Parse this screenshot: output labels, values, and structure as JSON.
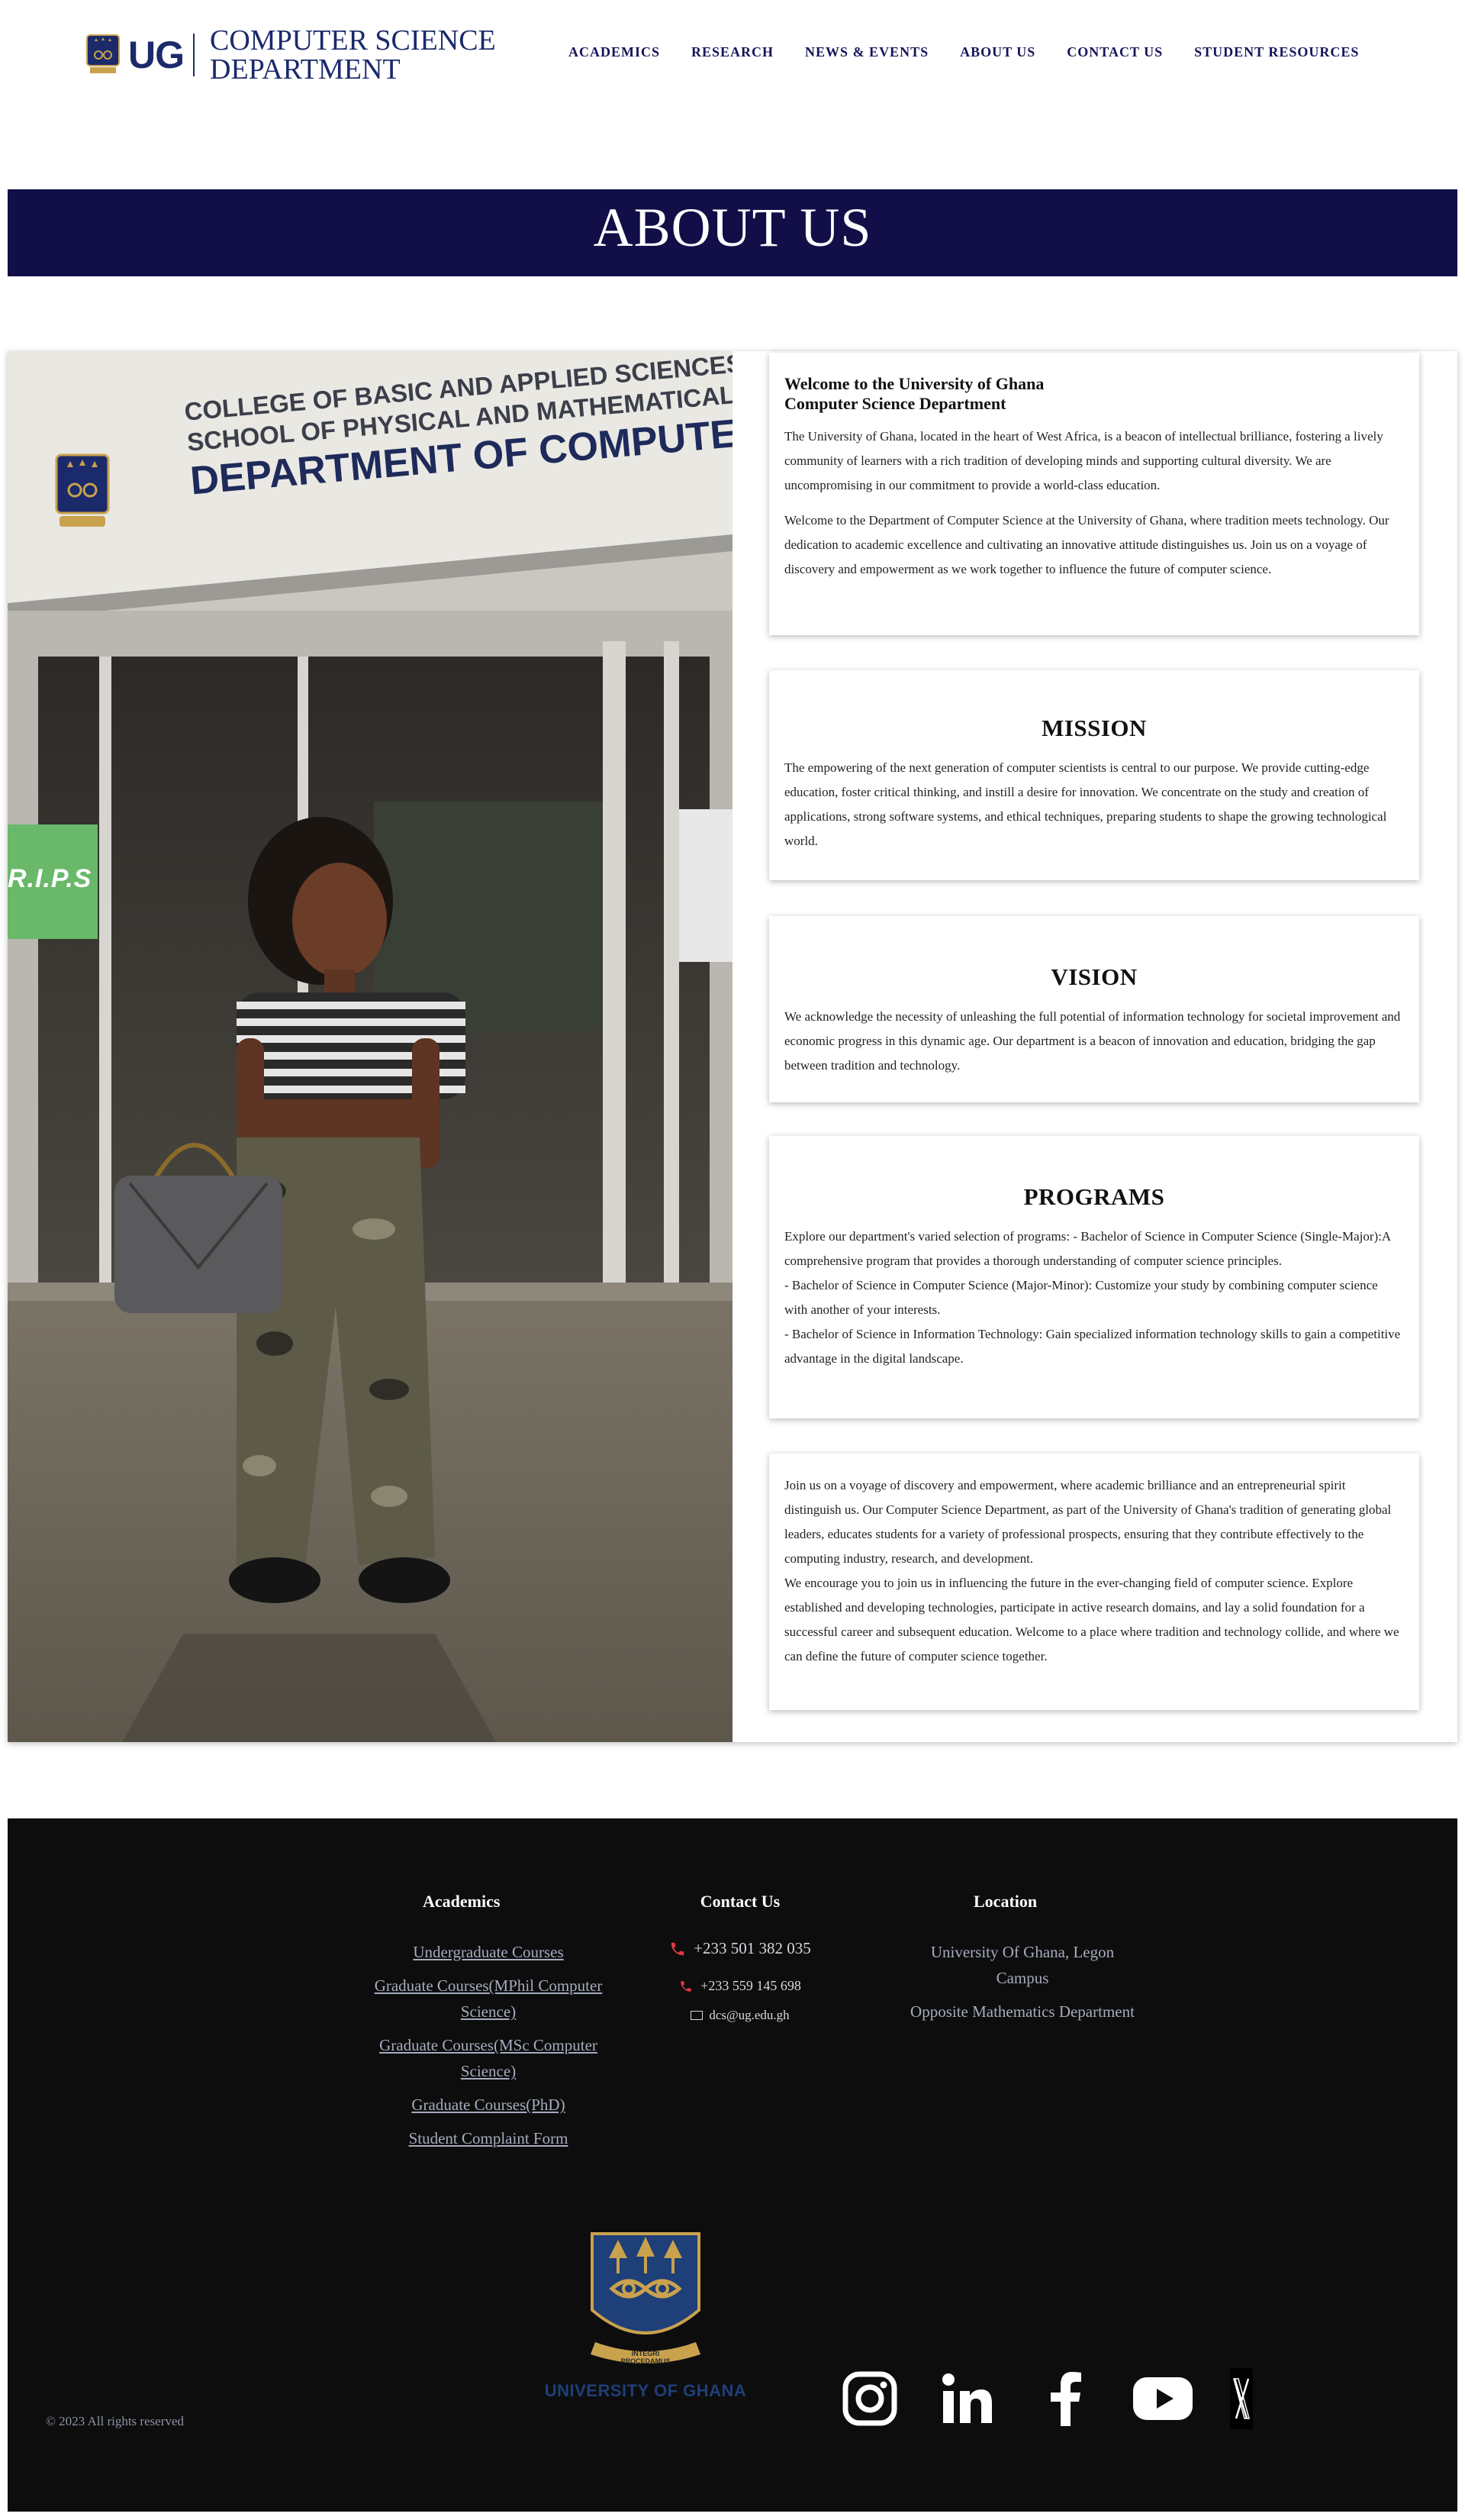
{
  "header": {
    "logo_ug": "UG",
    "dept_line1": "COMPUTER SCIENCE",
    "dept_line2": "DEPARTMENT",
    "nav": [
      "ACADEMICS",
      "RESEARCH",
      "NEWS & EVENTS",
      "ABOUT US",
      "CONTACT US",
      "STUDENT RESOURCES"
    ]
  },
  "banner": {
    "title": "ABOUT US"
  },
  "intro": {
    "heading_line1": "Welcome to the University of Ghana",
    "heading_line2": "Computer Science Department",
    "para1": "The University of Ghana, located in the heart of West Africa, is a beacon of intellectual brilliance, fostering a lively community of learners with a rich tradition of developing minds and supporting cultural diversity. We are uncompromising in our commitment to provide a world-class education.",
    "para2": "Welcome to the Department of Computer Science at the University of Ghana, where tradition meets technology. Our dedication to academic excellence and cultivating an innovative attitude distinguishes us. Join us on a voyage of discovery and empowerment as we work together to influence the future of computer science."
  },
  "photo": {
    "sign_line1": "COLLEGE OF BASIC AND APPLIED SCIENCES",
    "sign_line2": "SCHOOL OF PHYSICAL AND MATHEMATICAL SCIENCES",
    "sign_line3": "DEPARTMENT OF COMPUTER SCIEN",
    "side_sign": "R.I.P.S"
  },
  "mission": {
    "title": "MISSION",
    "text": "The empowering of the next generation of computer scientists is central to our purpose. We provide cutting-edge education, foster critical thinking, and instill a desire for innovation. We concentrate on the study and creation of applications, strong software systems, and ethical techniques, preparing students to shape the growing technological world."
  },
  "vision": {
    "title": "VISION",
    "text": "We acknowledge the necessity of unleashing the full potential of information technology for societal improvement and economic progress in this dynamic age. Our department is a beacon of innovation and education, bridging the gap between tradition and technology."
  },
  "programs": {
    "title": "PROGRAMS",
    "line1": "Explore our department's varied selection of programs: - Bachelor of Science in Computer Science (Single-Major):A comprehensive program that provides a thorough understanding of computer science principles.",
    "line2": "- Bachelor of Science in Computer Science (Major-Minor): Customize your study by combining computer science with another of your interests.",
    "line3": "- Bachelor of Science in Information Technology: Gain specialized information technology skills to gain a competitive advantage in the digital landscape."
  },
  "closing": {
    "para1": "Join us on a voyage of discovery and empowerment, where academic brilliance and an entrepreneurial spirit distinguish us. Our Computer Science Department, as part of the University of Ghana's tradition of generating global leaders, educates students for a variety of professional prospects, ensuring that they contribute effectively to the computing industry, research, and development.",
    "para2": "We encourage you to join us in influencing the future in the ever-changing field of computer science. Explore established and developing technologies, participate in active research domains, and lay a solid foundation for a successful career and subsequent education. Welcome to a place where tradition and technology collide, and where we can define the future of computer science together."
  },
  "footer": {
    "academics": {
      "title": "Academics",
      "links": [
        "Undergraduate Courses",
        "Graduate Courses(MPhil Computer Science)",
        "Graduate Courses(MSc Computer Science)",
        "Graduate Courses(PhD)",
        "Student Complaint Form"
      ]
    },
    "contact": {
      "title": "Contact Us",
      "phone1": "+233 501 382 035",
      "phone2": "+233 559 145 698",
      "email": "dcs@ug.edu.gh"
    },
    "location": {
      "title": "Location",
      "line1": "University Of Ghana, Legon Campus",
      "line2": "Opposite Mathematics Department"
    },
    "crest_motto": "INTEGRI PROCEDAMUS",
    "university_name": "UNIVERSITY OF GHANA",
    "socials": [
      "instagram-icon",
      "linkedin-icon",
      "facebook-icon",
      "youtube-icon",
      "x-icon"
    ],
    "copyright": "© 2023 All rights reserved"
  },
  "colors": {
    "brand_navy": "#110e48",
    "nav_text": "#17135a",
    "footer_bg": "#0d0d0d",
    "footer_link": "#a6acbf",
    "phone_icon": "#e53945",
    "crest_gold": "#c9a24e",
    "crest_blue": "#1e3f78"
  }
}
